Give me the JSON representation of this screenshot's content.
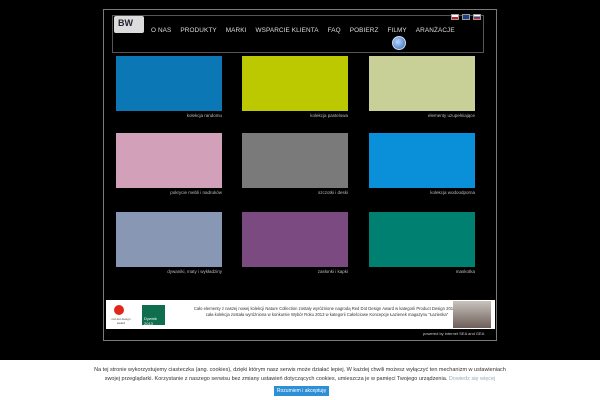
{
  "logo": {
    "text": "BW"
  },
  "nav": [
    "O NAS",
    "PRODUKTY",
    "MARKI",
    "WSPARCIE KLIENTA",
    "FAQ",
    "POBIERZ",
    "FILMY",
    "ARANŻACJE"
  ],
  "swatches": [
    {
      "color": "#0b78b5",
      "caption": "kolekcja randomu"
    },
    {
      "color": "#bcc800",
      "caption": "kolekcja pastelowa"
    },
    {
      "color": "#c8d098",
      "caption": "elementy uzupełniające"
    },
    {
      "color": "#d2a0b8",
      "caption": "pokrycie mebli i nadruków"
    },
    {
      "color": "#7a7a7a",
      "caption": "szczotki i deski"
    },
    {
      "color": "#0a90d8",
      "caption": "kolekcja wodoodporna"
    },
    {
      "color": "#8898b4",
      "caption": "dywaniki, maty i wykładziny"
    },
    {
      "color": "#7a4a80",
      "caption": "zasłonki i kapki"
    },
    {
      "color": "#008070",
      "caption": "maskotka"
    }
  ],
  "banner": {
    "award1": "red dot design award",
    "award2": "Dywnik 2013",
    "text": "Cało elementy z naszej nowej kolekcji Nature Collection zostały wyróżnione nagrodą Red Dot Design Award w kategorii Product Design 2013, a cała kolekcja została wyróżniona w konkursie Wybór Roku 2013 w kategorii Całościowe Koncepcje Łazienek magazynu \"Łazienka\""
  },
  "powered": "powered by internet SEA and GEA",
  "cookie": {
    "message": "Na tej stronie wykorzystujemy ciasteczka (ang. cookies), dzięki którym nasz serwis może działać lepiej. W każdej chwili możesz wyłączyć ten mechanizm w ustawieniach swojej przeglądarki. Korzystanie z naszego serwisu bez zmiany ustawień dotyczących cookies, umieszcza je w pamięci Twojego urządzenia.",
    "link": "Dowiedz się więcej",
    "button": "Rozumiem i akceptuję"
  }
}
